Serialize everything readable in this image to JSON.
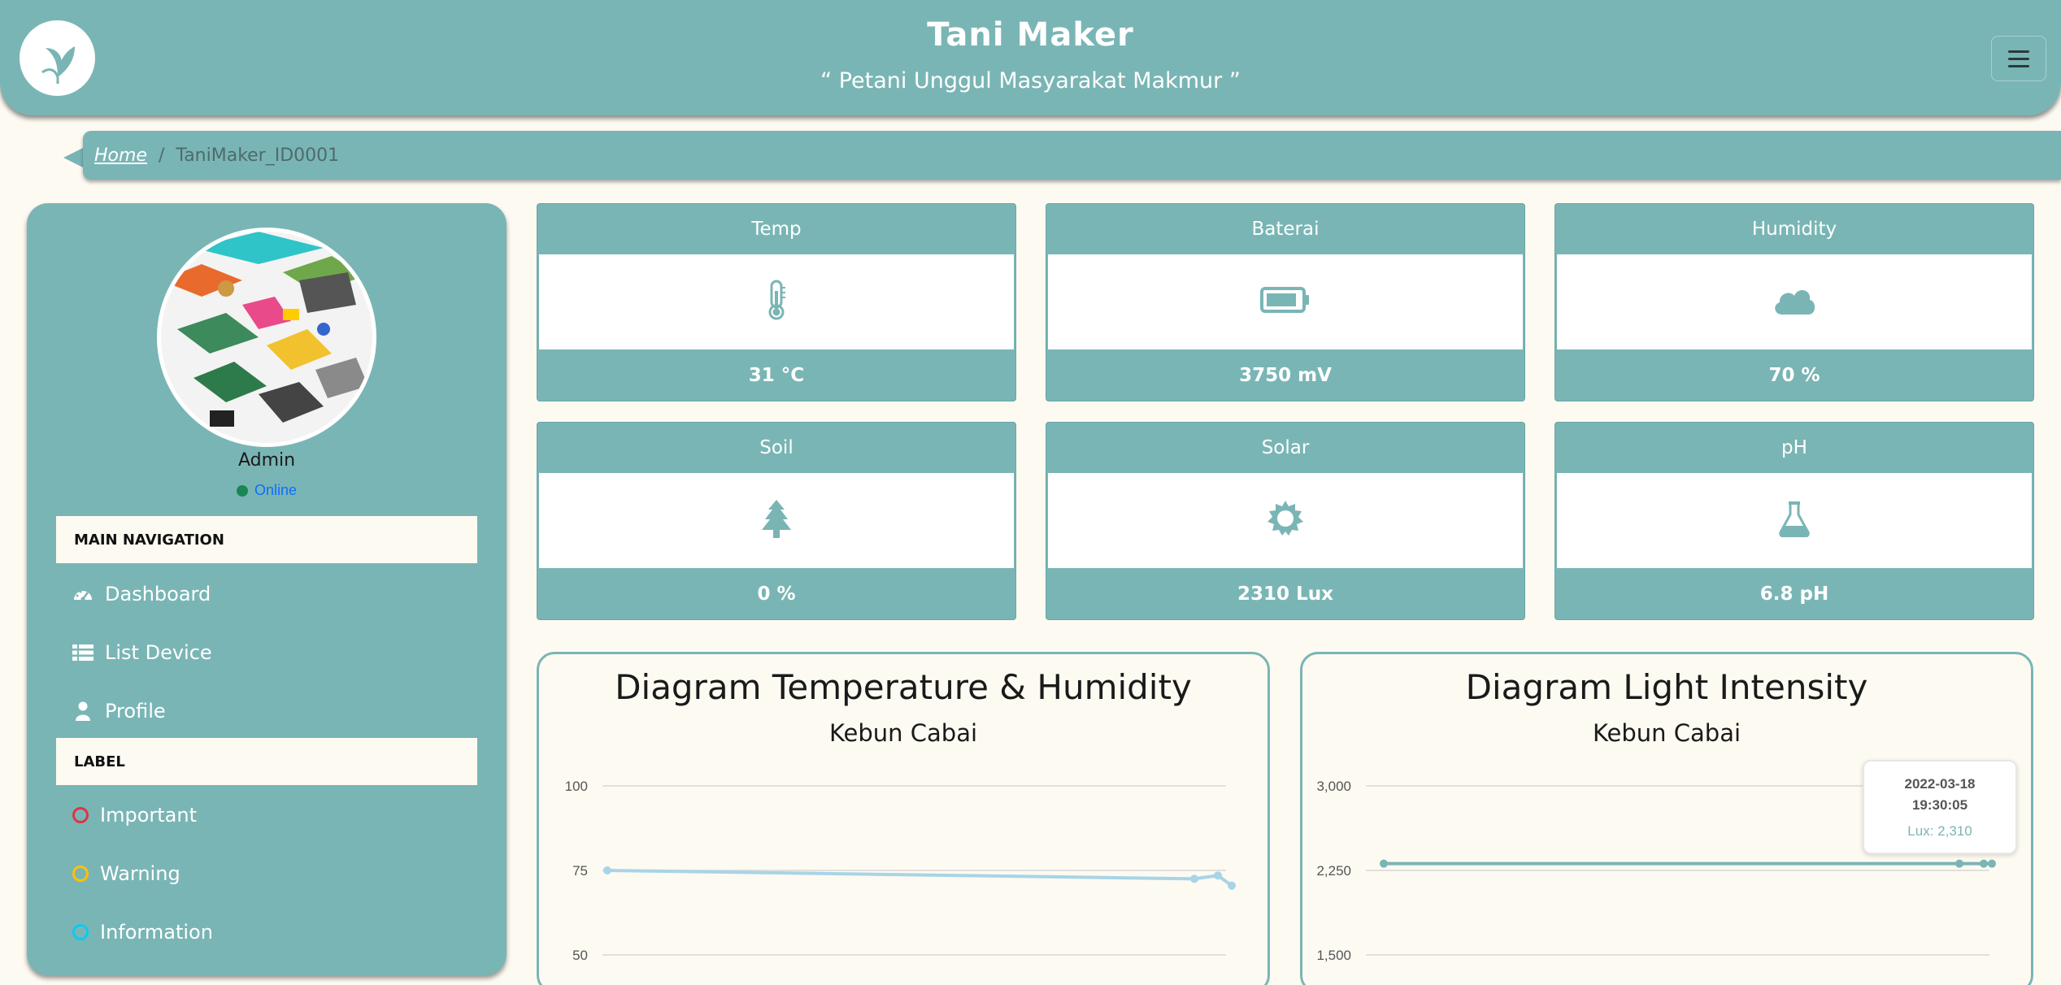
{
  "header": {
    "title": "Tani Maker",
    "tagline": "“ Petani Unggul Masyarakat Makmur ”",
    "logo_icon": "leaf-logo-icon",
    "menu_icon": "hamburger-menu-icon"
  },
  "breadcrumb": {
    "home": "Home",
    "separator": "/",
    "current": "TaniMaker_ID0001"
  },
  "sidebar": {
    "user_name": "Admin",
    "status": "Online",
    "main_nav_header": "MAIN NAVIGATION",
    "nav_items": [
      {
        "label": "Dashboard",
        "icon": "gauge-icon"
      },
      {
        "label": "List Device",
        "icon": "list-icon"
      },
      {
        "label": "Profile",
        "icon": "user-icon"
      }
    ],
    "label_header": "LABEL",
    "labels": [
      {
        "label": "Important",
        "color": "#dc3545"
      },
      {
        "label": "Warning",
        "color": "#ffc107"
      },
      {
        "label": "Information",
        "color": "#0dcaf0"
      }
    ]
  },
  "cards": [
    {
      "title": "Temp",
      "value": "31 °C",
      "icon": "thermometer-icon"
    },
    {
      "title": "Baterai",
      "value": "3750 mV",
      "icon": "battery-icon"
    },
    {
      "title": "Humidity",
      "value": "70 %",
      "icon": "cloud-icon"
    },
    {
      "title": "Soil",
      "value": "0 %",
      "icon": "tree-icon"
    },
    {
      "title": "Solar",
      "value": "2310 Lux",
      "icon": "sun-icon"
    },
    {
      "title": "pH",
      "value": "6.8 pH",
      "icon": "flask-icon"
    }
  ],
  "colors": {
    "primary": "#7ab5b5",
    "background": "#fdfaf2",
    "series_temp_humidity": "#a8d4e6",
    "series_lux": "#7ab5b5"
  },
  "chart_data": [
    {
      "type": "line",
      "title": "Diagram Temperature & Humidity",
      "subtitle": "Kebun Cabai",
      "xlabel": "",
      "ylabel": "",
      "yticks": [
        "100",
        "75",
        "50"
      ],
      "ylim": [
        40,
        100
      ],
      "grid": true,
      "series": [
        {
          "values": [
            75,
            72.5,
            73.5,
            70.5
          ]
        }
      ]
    },
    {
      "type": "line",
      "title": "Diagram Light Intensity",
      "subtitle": "Kebun Cabai",
      "xlabel": "",
      "ylabel": "",
      "yticks": [
        "3,000",
        "2,250",
        "1,500"
      ],
      "ylim": [
        1250,
        3000
      ],
      "grid": true,
      "series": [
        {
          "values": [
            2310,
            2310,
            2310,
            2310
          ]
        }
      ],
      "tooltip": {
        "date": "2022-03-18",
        "time": "19:30:05",
        "value": "Lux: 2,310"
      }
    }
  ]
}
